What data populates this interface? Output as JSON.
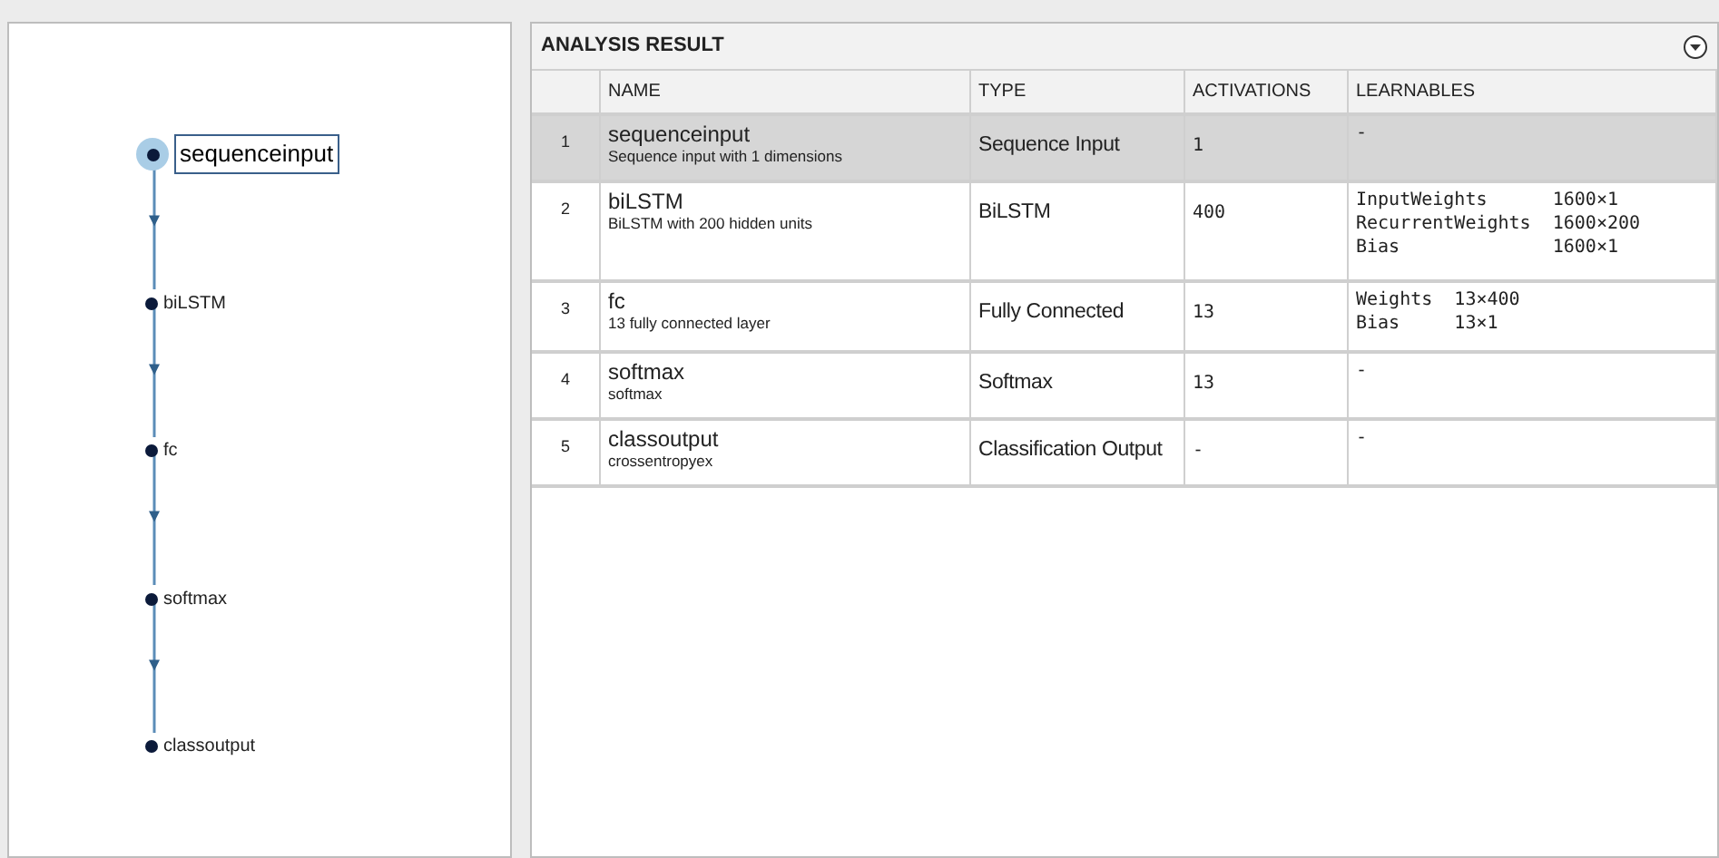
{
  "graph": {
    "nodes": [
      {
        "name": "sequenceinput",
        "selected": true
      },
      {
        "name": "biLSTM",
        "selected": false
      },
      {
        "name": "fc",
        "selected": false
      },
      {
        "name": "softmax",
        "selected": false
      },
      {
        "name": "classoutput",
        "selected": false
      }
    ]
  },
  "analysis": {
    "title": "ANALYSIS RESULT",
    "columns": [
      "NAME",
      "TYPE",
      "ACTIVATIONS",
      "LEARNABLES"
    ],
    "rows": [
      {
        "index": "1",
        "name": "sequenceinput",
        "description": "Sequence input with 1 dimensions",
        "type": "Sequence Input",
        "activations": "1",
        "learnables": [
          "-"
        ],
        "selected": true
      },
      {
        "index": "2",
        "name": "biLSTM",
        "description": "BiLSTM with 200 hidden units",
        "type": "BiLSTM",
        "activations": "400",
        "learnables": [
          "InputWeights      1600×1",
          "RecurrentWeights  1600×200",
          "Bias              1600×1"
        ],
        "selected": false
      },
      {
        "index": "3",
        "name": "fc",
        "description": "13 fully connected layer",
        "type": "Fully Connected",
        "activations": "13",
        "learnables": [
          "Weights  13×400",
          "Bias     13×1"
        ],
        "selected": false
      },
      {
        "index": "4",
        "name": "softmax",
        "description": "softmax",
        "type": "Softmax",
        "activations": "13",
        "learnables": [
          "-"
        ],
        "selected": false
      },
      {
        "index": "5",
        "name": "classoutput",
        "description": "crossentropyex",
        "type": "Classification Output",
        "activations": "-",
        "learnables": [
          "-"
        ],
        "selected": false
      }
    ]
  }
}
